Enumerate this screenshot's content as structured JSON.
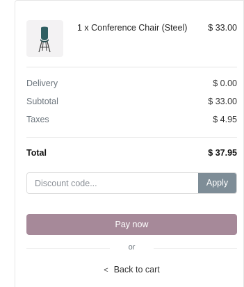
{
  "order_summary": {
    "item": {
      "name": "1 x Conference Chair (Steel)",
      "price": "$ 33.00",
      "image_icon": "chair-icon"
    },
    "delivery": {
      "label": "Delivery",
      "value": "$ 0.00"
    },
    "subtotal": {
      "label": "Subtotal",
      "value": "$ 33.00"
    },
    "taxes": {
      "label": "Taxes",
      "value": "$ 4.95"
    },
    "total": {
      "label": "Total",
      "value": "$ 37.95"
    }
  },
  "discount": {
    "placeholder": "Discount code...",
    "value": "",
    "apply_label": "Apply"
  },
  "actions": {
    "pay_label": "Pay now",
    "or_label": "or",
    "back_label": "Back to cart",
    "back_icon": "chevron-left-icon"
  },
  "colors": {
    "pay_button": "#a68999",
    "apply_button": "#7e8d97",
    "chair_seat": "#2f5f62"
  }
}
